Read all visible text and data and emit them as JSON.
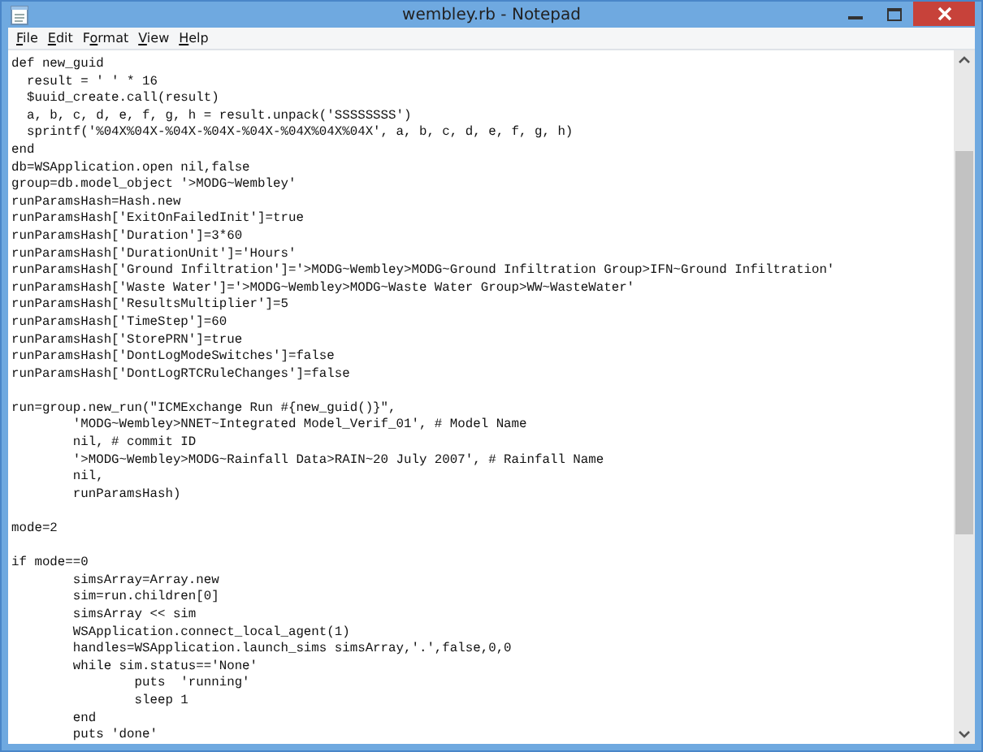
{
  "window": {
    "title": "wembley.rb - Notepad"
  },
  "menu": [
    {
      "key": "F",
      "tail": "ile"
    },
    {
      "key": "E",
      "tail": "dit"
    },
    {
      "lead": "F",
      "key": "o",
      "tail": "rmat"
    },
    {
      "key": "V",
      "tail": "iew"
    },
    {
      "key": "H",
      "tail": "elp"
    }
  ],
  "editor": {
    "content": "def new_guid\n  result = ' ' * 16\n  $uuid_create.call(result)\n  a, b, c, d, e, f, g, h = result.unpack('SSSSSSSS')\n  sprintf('%04X%04X-%04X-%04X-%04X-%04X%04X%04X', a, b, c, d, e, f, g, h)\nend\ndb=WSApplication.open nil,false\ngroup=db.model_object '>MODG~Wembley'\nrunParamsHash=Hash.new\nrunParamsHash['ExitOnFailedInit']=true\nrunParamsHash['Duration']=3*60\nrunParamsHash['DurationUnit']='Hours'\nrunParamsHash['Ground Infiltration']='>MODG~Wembley>MODG~Ground Infiltration Group>IFN~Ground Infiltration'\nrunParamsHash['Waste Water']='>MODG~Wembley>MODG~Waste Water Group>WW~WasteWater'\nrunParamsHash['ResultsMultiplier']=5\nrunParamsHash['TimeStep']=60\nrunParamsHash['StorePRN']=true\nrunParamsHash['DontLogModeSwitches']=false\nrunParamsHash['DontLogRTCRuleChanges']=false\n\nrun=group.new_run(\"ICMExchange Run #{new_guid()}\",\n        'MODG~Wembley>NNET~Integrated Model_Verif_01', # Model Name\n        nil, # commit ID\n        '>MODG~Wembley>MODG~Rainfall Data>RAIN~20 July 2007', # Rainfall Name\n        nil,\n        runParamsHash)\n\nmode=2\n\nif mode==0\n        simsArray=Array.new\n        sim=run.children[0]\n        simsArray << sim\n        WSApplication.connect_local_agent(1)\n        handles=WSApplication.launch_sims simsArray,'.',false,0,0\n        while sim.status=='None'\n                puts  'running'\n                sleep 1\n        end\n        puts 'done'"
  }
}
